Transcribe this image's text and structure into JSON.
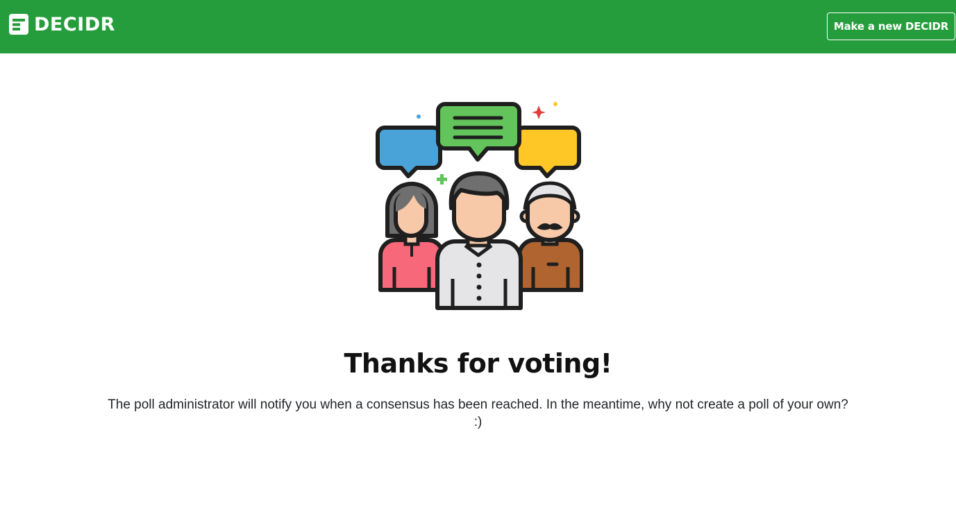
{
  "navbar": {
    "brand_name": "DECIDR",
    "new_button_label": "Make a new DECIDR",
    "background_color": "#259d3c"
  },
  "illustration": {
    "icon": "group-chat-people-icon",
    "colors": {
      "bubble_left": "#4aa3d8",
      "bubble_center": "#62c45a",
      "bubble_right": "#ffc726",
      "shirt_left": "#f7697a",
      "shirt_center": "#e5e5e8",
      "shirt_right": "#b0642f",
      "skin": "#f7c9a8",
      "outline": "#1f1f1f"
    }
  },
  "content": {
    "title": "Thanks for voting!",
    "message": "The poll administrator will notify you when a consensus has been reached. In the meantime, why not create a poll of your own? :)"
  }
}
